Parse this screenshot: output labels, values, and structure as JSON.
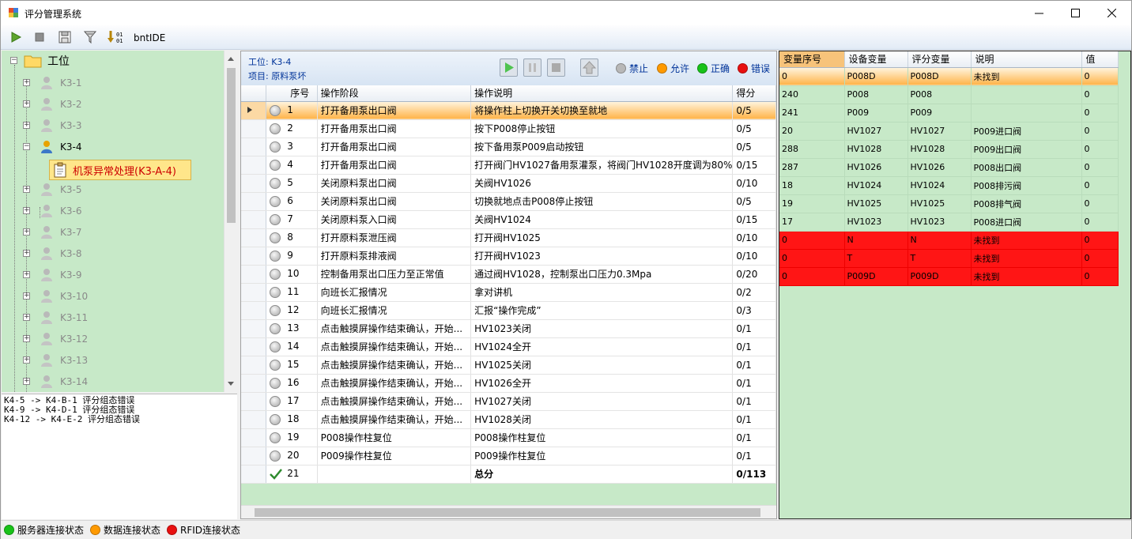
{
  "window": {
    "title": "评分管理系统",
    "toolbar_label": "bntIDE"
  },
  "tree": {
    "root": "工位",
    "nodes": [
      {
        "label": "K3-1",
        "active": false
      },
      {
        "label": "K3-2",
        "active": false
      },
      {
        "label": "K3-3",
        "active": false
      },
      {
        "label": "K3-4",
        "active": true
      },
      {
        "label": "K3-5",
        "active": false
      },
      {
        "label": "K3-6",
        "active": false
      },
      {
        "label": "K3-7",
        "active": false
      },
      {
        "label": "K3-8",
        "active": false
      },
      {
        "label": "K3-9",
        "active": false
      },
      {
        "label": "K3-10",
        "active": false
      },
      {
        "label": "K3-11",
        "active": false
      },
      {
        "label": "K3-12",
        "active": false
      },
      {
        "label": "K3-13",
        "active": false
      },
      {
        "label": "K3-14",
        "active": false
      }
    ],
    "selected_child": "机泵异常处理(K3-A-4)"
  },
  "log": [
    "K4-5 -> K4-B-1 评分组态错误",
    "K4-9 -> K4-D-1 评分组态错误",
    "K4-12 -> K4-E-2 评分组态错误"
  ],
  "mid": {
    "station": "工位: K3-4",
    "project": "项目: 原料泵坏",
    "legend": [
      {
        "label": "禁止",
        "color": "#b8b8b8"
      },
      {
        "label": "允许",
        "color": "#ff9a00"
      },
      {
        "label": "正确",
        "color": "#19c219"
      },
      {
        "label": "错误",
        "color": "#e81010"
      }
    ],
    "columns": [
      "序号",
      "操作阶段",
      "操作说明",
      "得分"
    ],
    "rows": [
      [
        "1",
        "打开备用泵出口阀",
        "将操作柱上切换开关切换至就地",
        "0/5"
      ],
      [
        "2",
        "打开备用泵出口阀",
        "按下P008停止按钮",
        "0/5"
      ],
      [
        "3",
        "打开备用泵出口阀",
        "按下备用泵P009启动按钮",
        "0/5"
      ],
      [
        "4",
        "打开备用泵出口阀",
        "打开阀门HV1027备用泵灌泵，将阀门HV1028开度调为80%",
        "0/15"
      ],
      [
        "5",
        "关闭原料泵出口阀",
        "关阀HV1026",
        "0/10"
      ],
      [
        "6",
        "关闭原料泵出口阀",
        "切换就地点击P008停止按钮",
        "0/5"
      ],
      [
        "7",
        "关闭原料泵入口阀",
        "关阀HV1024",
        "0/15"
      ],
      [
        "8",
        "打开原料泵泄压阀",
        "打开阀HV1025",
        "0/10"
      ],
      [
        "9",
        "打开原料泵排液阀",
        "打开阀HV1023",
        "0/10"
      ],
      [
        "10",
        "控制备用泵出口压力至正常值",
        "通过阀HV1028，控制泵出口压力0.3Mpa",
        "0/20"
      ],
      [
        "11",
        "向班长汇报情况",
        "拿对讲机",
        "0/2"
      ],
      [
        "12",
        "向班长汇报情况",
        "汇报“操作完成”",
        "0/3"
      ],
      [
        "13",
        "点击触摸屏操作结束确认，开始...",
        "HV1023关闭",
        "0/1"
      ],
      [
        "14",
        "点击触摸屏操作结束确认，开始...",
        "HV1024全开",
        "0/1"
      ],
      [
        "15",
        "点击触摸屏操作结束确认，开始...",
        "HV1025关闭",
        "0/1"
      ],
      [
        "16",
        "点击触摸屏操作结束确认，开始...",
        "HV1026全开",
        "0/1"
      ],
      [
        "17",
        "点击触摸屏操作结束确认，开始...",
        "HV1027关闭",
        "0/1"
      ],
      [
        "18",
        "点击触摸屏操作结束确认，开始...",
        "HV1028关闭",
        "0/1"
      ],
      [
        "19",
        "P008操作柱复位",
        "P008操作柱复位",
        "0/1"
      ],
      [
        "20",
        "P009操作柱复位",
        "P009操作柱复位",
        "0/1"
      ]
    ],
    "total_row": [
      "21",
      "",
      "总分",
      "0/113"
    ]
  },
  "right": {
    "columns": [
      "变量序号",
      "设备变量",
      "评分变量",
      "说明",
      "值"
    ],
    "rows": [
      {
        "cells": [
          "0",
          "P008D",
          "P008D",
          "未找到",
          "0"
        ],
        "state": "sel"
      },
      {
        "cells": [
          "240",
          "P008",
          "P008",
          "",
          "0"
        ],
        "state": ""
      },
      {
        "cells": [
          "241",
          "P009",
          "P009",
          "",
          "0"
        ],
        "state": ""
      },
      {
        "cells": [
          "20",
          "HV1027",
          "HV1027",
          "P009进口阀",
          "0"
        ],
        "state": ""
      },
      {
        "cells": [
          "288",
          "HV1028",
          "HV1028",
          "P009出口阀",
          "0"
        ],
        "state": ""
      },
      {
        "cells": [
          "287",
          "HV1026",
          "HV1026",
          "P008出口阀",
          "0"
        ],
        "state": ""
      },
      {
        "cells": [
          "18",
          "HV1024",
          "HV1024",
          "P008排污阀",
          "0"
        ],
        "state": ""
      },
      {
        "cells": [
          "19",
          "HV1025",
          "HV1025",
          "P008排气阀",
          "0"
        ],
        "state": ""
      },
      {
        "cells": [
          "17",
          "HV1023",
          "HV1023",
          "P008进口阀",
          "0"
        ],
        "state": ""
      },
      {
        "cells": [
          "0",
          "N",
          "N",
          "未找到",
          "0"
        ],
        "state": "err"
      },
      {
        "cells": [
          "0",
          "T",
          "T",
          "未找到",
          "0"
        ],
        "state": "err"
      },
      {
        "cells": [
          "0",
          "P009D",
          "P009D",
          "未找到",
          "0"
        ],
        "state": "err"
      }
    ]
  },
  "status": [
    {
      "label": "服务器连接状态",
      "color": "#19c219"
    },
    {
      "label": "数据连接状态",
      "color": "#ff9a00"
    },
    {
      "label": "RFID连接状态",
      "color": "#e81010"
    }
  ]
}
